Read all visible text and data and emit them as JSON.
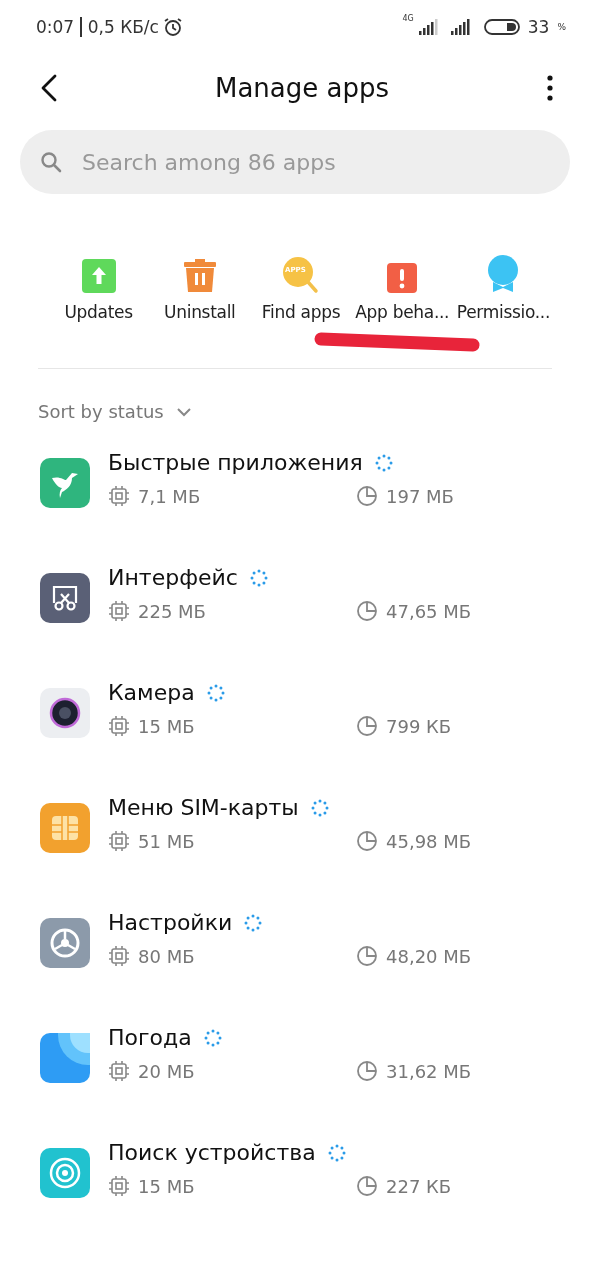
{
  "status_bar": {
    "time": "0:07",
    "speed": "0,5 КБ/с",
    "network": "4G",
    "battery": "33",
    "battery_unit": "%"
  },
  "header": {
    "title": "Manage apps"
  },
  "search": {
    "placeholder": "Search among 86 apps"
  },
  "shortcuts": [
    {
      "kind": "updates",
      "label": "Updates"
    },
    {
      "kind": "uninstall",
      "label": "Uninstall"
    },
    {
      "kind": "find",
      "label": "Find apps",
      "badge": "APPS"
    },
    {
      "kind": "behavior",
      "label": "App beha..."
    },
    {
      "kind": "permissions",
      "label": "Permissio..."
    }
  ],
  "sort": {
    "label": "Sort by status"
  },
  "apps": [
    {
      "kind": "quick",
      "name": "Быстрые приложения",
      "memory": "7,1 МБ",
      "storage": "197 МБ"
    },
    {
      "kind": "interface",
      "name": "Интерфейс",
      "memory": "225 МБ",
      "storage": "47,65 МБ"
    },
    {
      "kind": "camera",
      "name": "Камера",
      "memory": "15 МБ",
      "storage": "799 КБ"
    },
    {
      "kind": "sim",
      "name": "Меню SIM-карты",
      "memory": "51 МБ",
      "storage": "45,98 МБ"
    },
    {
      "kind": "settings",
      "name": "Настройки",
      "memory": "80 МБ",
      "storage": "48,20 МБ"
    },
    {
      "kind": "weather",
      "name": "Погода",
      "memory": "20 МБ",
      "storage": "31,62 МБ"
    },
    {
      "kind": "finder",
      "name": "Поиск устройства",
      "memory": "15 МБ",
      "storage": "227 КБ"
    }
  ]
}
